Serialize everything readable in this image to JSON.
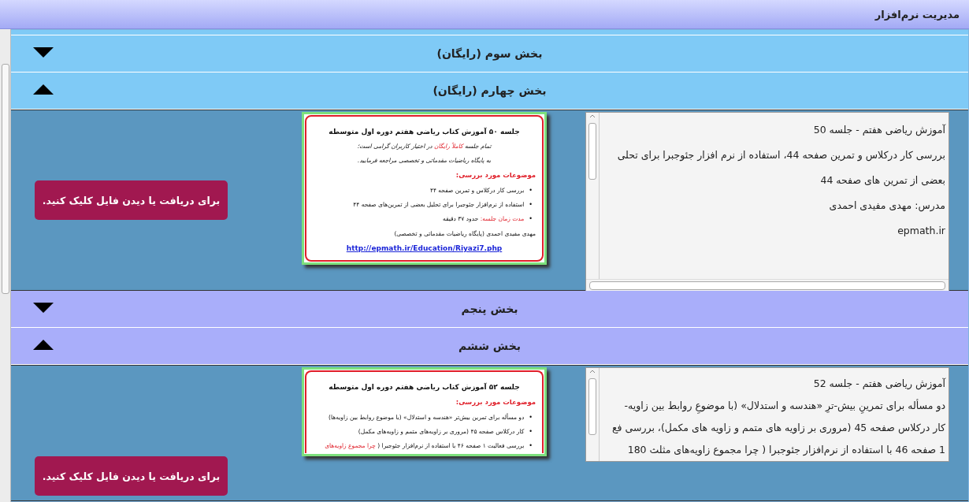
{
  "window": {
    "title": "مدیریت نرم‌افزار"
  },
  "sections": [
    {
      "title": "بخش سوم (رایگان)",
      "expanded": false,
      "color": "#7fcaf6"
    },
    {
      "title": "بخش چهارم (رایگان)",
      "expanded": true,
      "color": "#7fcaf6",
      "content": {
        "button": "برای دریافت یا دیدن فایل کلیک کنید.",
        "document": {
          "heading": "جلسه ۵۰ آموزش کتاب ریاضی هفتم دوره اول متوسطه",
          "intro": [
            [
              {
                "text": "تمام جلسه ",
                "highlight": false
              },
              {
                "text": "کاملاً رایگان",
                "highlight": true
              },
              {
                "text": " در اختیار کاربران گرامی است؛",
                "highlight": false
              }
            ],
            [
              {
                "text": "به پایگاه ریاضیات مقدماتی و تخصصی مراجعه فرمایید.",
                "highlight": false
              }
            ]
          ],
          "topics_label": "موضوعات مورد بررسی:",
          "bullet": "•",
          "bullets": [
            [
              {
                "text": "بررسی کار درکلاس و تمرین صفحه ۴۴",
                "highlight": false
              }
            ],
            [
              {
                "text": "استفاده از نرم‌افزار جئوجبرا برای تحلیل بعضی از تمرین‌های صفحه ۴۴",
                "highlight": false
              }
            ],
            [
              {
                "text": "مدت زمان جلسه:",
                "highlight": true
              },
              {
                "text": " حدود ۳۷ دقیقه",
                "highlight": false
              }
            ]
          ],
          "author": "مهدی مفیدی احمدی (پایگاه ریاضیات مقدماتی و تخصصی)",
          "link": "http://epmath.ir/Education/Riyazi7.php"
        },
        "description": [
          "آموزش ریاضی هفتم - جلسه 50",
          " بررسی کار درکلاس و تمرین صفحه 44، استفاده از نرم افزار جئوجبرا برای تحلی",
          "بعضی از تمرین های صفحه 44",
          "مدرس: مهدی مفیدی احمدی",
          "epmath.ir"
        ]
      }
    },
    {
      "title": "بخش پنجم",
      "expanded": false,
      "color": "#a9aefa"
    },
    {
      "title": "بخش ششم",
      "expanded": true,
      "color": "#a9aefa",
      "content": {
        "button": "برای دریافت یا دیدن فایل کلیک کنید.",
        "document": {
          "heading": "جلسه ۵۲ آموزش کتاب ریاضی هفتم دوره اول متوسطه",
          "bullet": "•",
          "topics_label": "موضوعات مورد بررسی:",
          "bullets": [
            [
              {
                "text": "دو مسأله برای تمرین بیش‌تر «هندسه و استدلال» (با موضوع روابط بین زاویه‌ها)",
                "highlight": false
              }
            ],
            [
              {
                "text": "کار درکلاس صفحه ۴۵ (مروری بر زاویه‌های متمم و زاویه‌های مکمل)",
                "highlight": false
              }
            ],
            [
              {
                "text": "بررسی فعالیت ۱ صفحه ۴۶ با استفاده از نرم‌افزار جئوجبرا ( ",
                "highlight": false
              },
              {
                "text": "چرا مجموع زاویه‌های",
                "highlight": true
              }
            ]
          ]
        },
        "description": [
          "آموزش ریاضی هفتم - جلسه 52",
          "دو مسأله برای تمرینِ بیش-ترِ «هندسه و استدلال» (با موضوعِ روابط بین زاویه-",
          "کار درکلاس صفحه 45 (مروری بر زاویه های متمم و زاویه های مکمل)، بررسی فع",
          "1 صفحه 46 با استفاده از نرم‌افزار جئوجبرا ( چرا مجموع زاویه‌های مثلث 180"
        ]
      }
    }
  ]
}
